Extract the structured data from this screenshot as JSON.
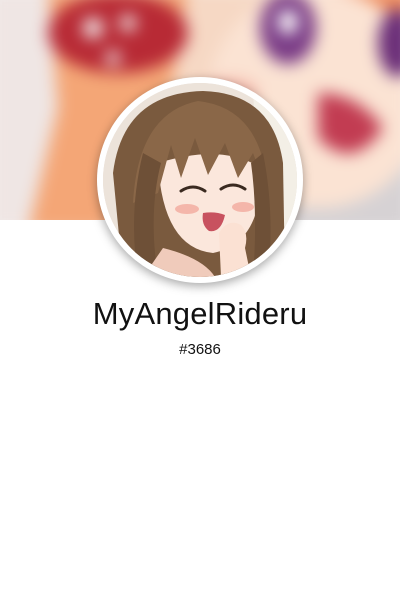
{
  "profile": {
    "username": "MyAngelRideru",
    "tag": "#3686"
  },
  "images": {
    "banner": "blurred-anime-artwork-banner",
    "avatar": "anime-girl-avatar"
  },
  "colors": {
    "background": "#ffffff",
    "text": "#111111",
    "banner_hair": "#f0a070",
    "banner_ribbon": "#b82a35",
    "banner_eye": "#7a3b86",
    "avatar_hair": "#7a5a3e"
  }
}
